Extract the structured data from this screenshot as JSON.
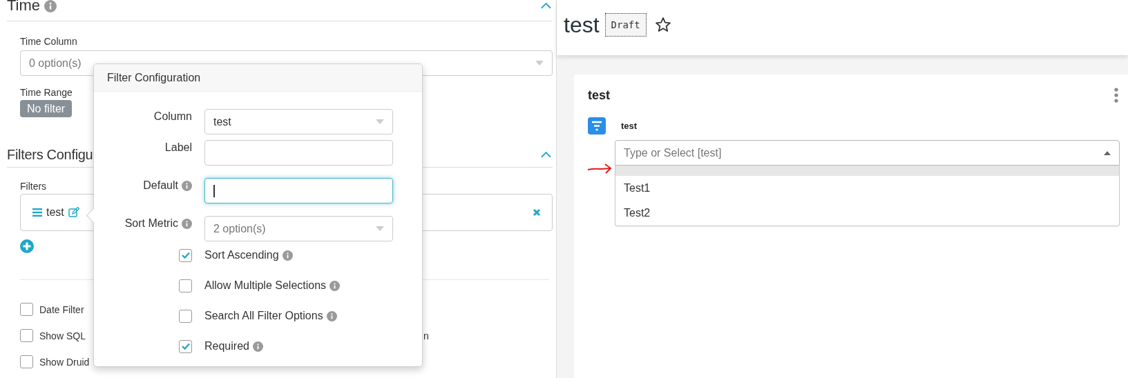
{
  "time_section": {
    "title": "Time",
    "expanded": true,
    "time_column": {
      "label": "Time Column",
      "placeholder": "0 option(s)"
    },
    "time_range": {
      "label": "Time Range",
      "value": "No filter"
    }
  },
  "filters_section": {
    "title": "Filters Configu",
    "expanded": true,
    "filters_label": "Filters",
    "filters": [
      {
        "label": "test"
      }
    ],
    "options": [
      {
        "label": "Date Filter",
        "checked": false
      },
      {
        "label": "Show SQL",
        "checked": false
      },
      {
        "label": "Show Druid",
        "checked": false
      }
    ],
    "covered_fragment": "n"
  },
  "popover": {
    "title": "Filter Configuration",
    "fields": [
      {
        "kind": "select",
        "label": "Column",
        "value": "test",
        "info": false,
        "focused": false
      },
      {
        "kind": "input",
        "label": "Label",
        "info": false,
        "focused": false
      },
      {
        "kind": "input",
        "label": "Default",
        "info": true,
        "focused": true
      },
      {
        "kind": "select",
        "label": "Sort Metric",
        "placeholder": "2 option(s)",
        "info": true,
        "focused": false
      },
      {
        "kind": "checkbox",
        "label": "Sort Ascending",
        "info": true,
        "checked": true
      },
      {
        "kind": "checkbox",
        "label": "Allow Multiple Selections",
        "info": true,
        "checked": false
      },
      {
        "kind": "checkbox",
        "label": "Search All Filter Options",
        "info": true,
        "checked": false
      },
      {
        "kind": "checkbox",
        "label": "Required",
        "info": true,
        "checked": true
      }
    ]
  },
  "dashboard": {
    "title": "test",
    "badge": "Draft",
    "starred": false,
    "chart": {
      "title": "test",
      "filter_label": "test",
      "select": {
        "placeholder": "Type or Select [test]",
        "expanded": true
      },
      "options": [
        {
          "selected": true
        },
        {
          "label": "Test1",
          "selected": false
        },
        {
          "label": "Test2",
          "selected": false
        }
      ]
    }
  }
}
